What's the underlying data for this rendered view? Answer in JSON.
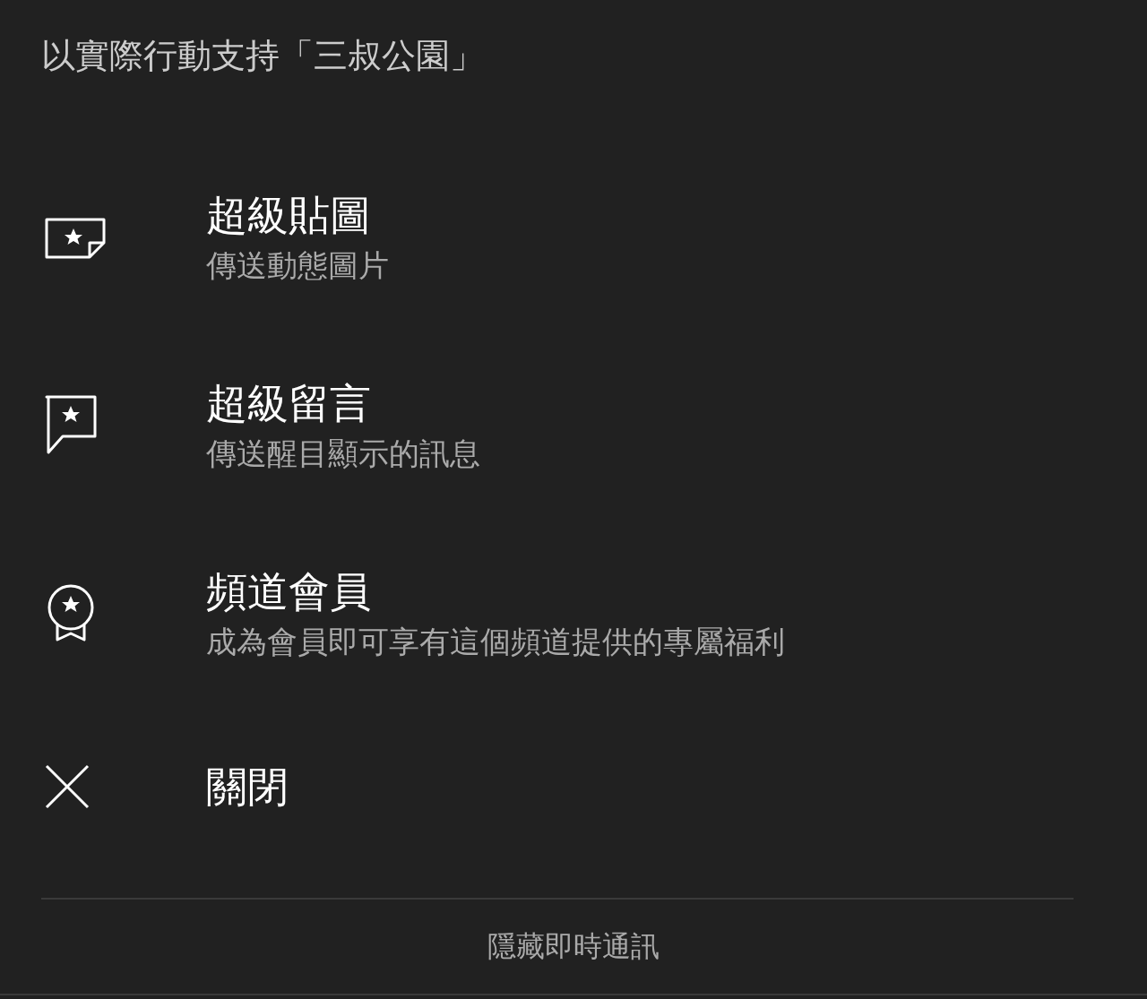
{
  "header": {
    "title": "以實際行動支持「三叔公園」"
  },
  "options": [
    {
      "kind": "sticker",
      "title": "超級貼圖",
      "subtitle": "傳送動態圖片"
    },
    {
      "kind": "comment",
      "title": "超級留言",
      "subtitle": "傳送醒目顯示的訊息"
    },
    {
      "kind": "membership",
      "title": "頻道會員",
      "subtitle": "成為會員即可享有這個頻道提供的專屬福利"
    },
    {
      "kind": "close",
      "title": "關閉"
    }
  ],
  "footer": {
    "button": "隱藏即時通訊"
  }
}
